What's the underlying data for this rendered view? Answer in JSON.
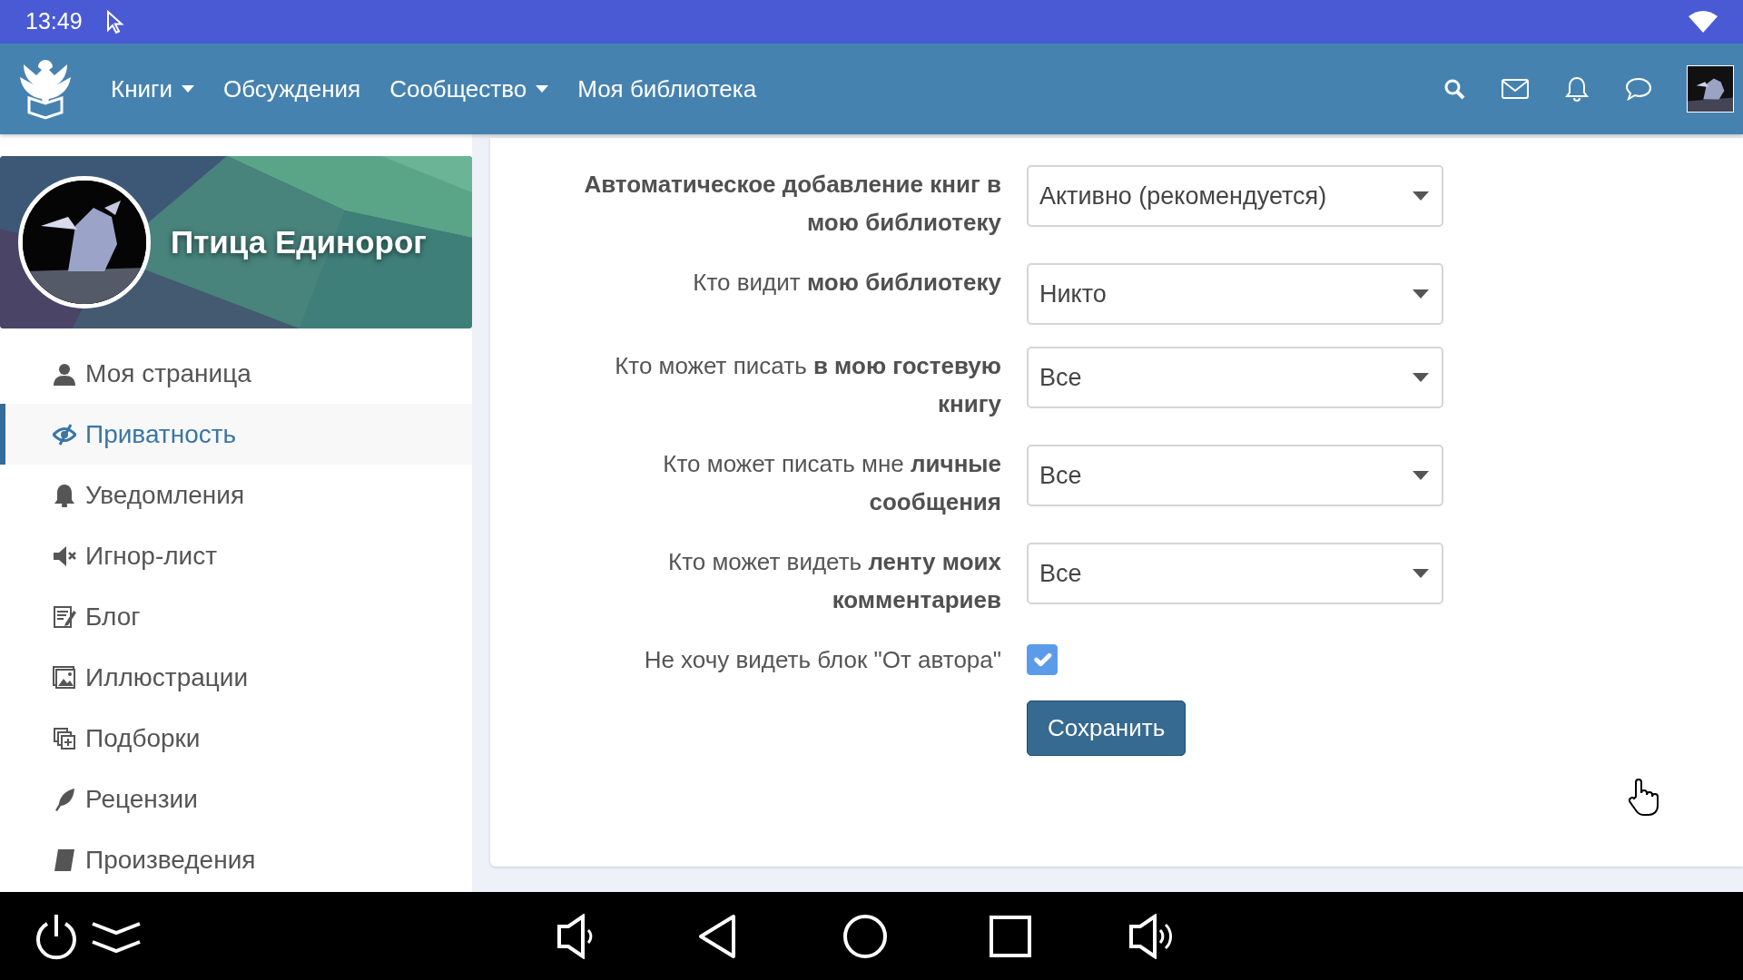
{
  "status_bar": {
    "time": "13:49"
  },
  "navbar": {
    "menu": [
      {
        "label": "Книги",
        "dropdown": true
      },
      {
        "label": "Обсуждения",
        "dropdown": false
      },
      {
        "label": "Сообщество",
        "dropdown": true
      },
      {
        "label": "Моя библиотека",
        "dropdown": false
      }
    ]
  },
  "profile": {
    "name": "Птица Единорог"
  },
  "sidebar": {
    "items": [
      {
        "label": "Моя страница",
        "selected": false
      },
      {
        "label": "Приватность",
        "selected": true
      },
      {
        "label": "Уведомления",
        "selected": false
      },
      {
        "label": "Игнор-лист",
        "selected": false
      },
      {
        "label": "Блог",
        "selected": false
      },
      {
        "label": "Иллюстрации",
        "selected": false
      },
      {
        "label": "Подборки",
        "selected": false
      },
      {
        "label": "Рецензии",
        "selected": false
      },
      {
        "label": "Произведения",
        "selected": false
      }
    ]
  },
  "form": {
    "fields": [
      {
        "kind": "select",
        "label": "**Автоматическое добавление книг в мою библиотеку**",
        "value": "Активно (рекомендуется)"
      },
      {
        "kind": "select",
        "label": "Кто видит **мою библиотеку**",
        "value": "Никто"
      },
      {
        "kind": "select",
        "label": "Кто может писать **в мою гостевую книгу**",
        "value": "Все"
      },
      {
        "kind": "select",
        "label": "Кто может писать мне **личные сообщения**",
        "value": "Все"
      },
      {
        "kind": "select",
        "label": "Кто может видеть **ленту моих комментариев**",
        "value": "Все"
      },
      {
        "kind": "checkbox",
        "label": "Не хочу видеть блок \"От автора\"",
        "checked": true
      }
    ],
    "save_button": "Сохранить"
  }
}
